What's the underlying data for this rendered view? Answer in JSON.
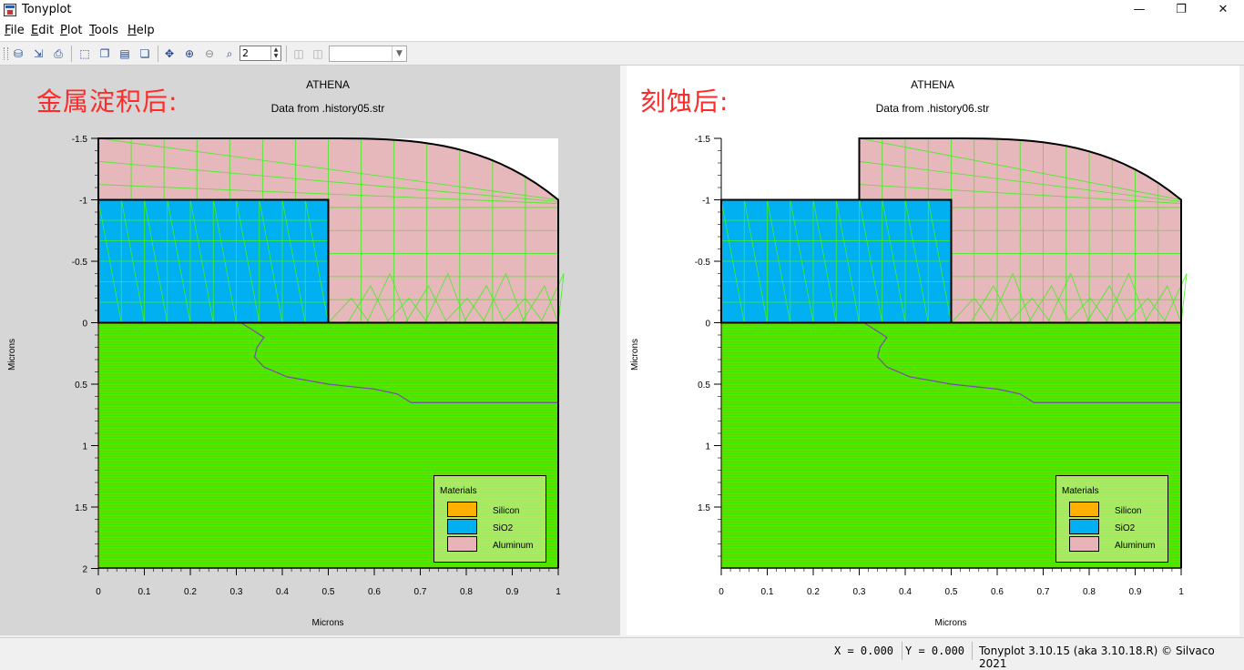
{
  "window": {
    "title": "Tonyplot",
    "minimize": "—",
    "maximize": "❐",
    "close": "✕"
  },
  "menu": [
    {
      "pre": "",
      "u": "F",
      "post": "ile"
    },
    {
      "pre": "",
      "u": "E",
      "post": "dit"
    },
    {
      "pre": "",
      "u": "P",
      "post": "lot"
    },
    {
      "pre": "",
      "u": "T",
      "post": "ools"
    },
    {
      "pre": "",
      "u": "H",
      "post": "elp"
    }
  ],
  "toolbar": {
    "icons": [
      "open-icon",
      "import-icon",
      "print-icon",
      "select-icon",
      "copy-icon",
      "delete-icon",
      "duplicate-icon",
      "pan-icon",
      "zoom-in-icon",
      "zoom-out-icon",
      "zoom-fit-icon"
    ],
    "zoom_value": "2",
    "extra_icons": [
      "prev-plot-icon",
      "next-plot-icon"
    ],
    "plot_select": ""
  },
  "plots": [
    {
      "annotation": "金属淀积后:",
      "title": "ATHENA",
      "subtitle": "Data from .history05.str",
      "ylabel": "Microns",
      "xlabel": "Microns",
      "xticks": [
        "0",
        "0.1",
        "0.2",
        "0.3",
        "0.4",
        "0.5",
        "0.6",
        "0.7",
        "0.8",
        "0.9",
        "1"
      ],
      "yticks": [
        "-1.5",
        "-1",
        "-0.5",
        "0",
        "0.5",
        "1",
        "1.5",
        "2"
      ],
      "etched": false,
      "legend": {
        "title": "Materials",
        "items": [
          {
            "label": "Silicon",
            "color": "#ffb000"
          },
          {
            "label": "SiO2",
            "color": "#00b0f0"
          },
          {
            "label": "Aluminum",
            "color": "#e8b4b8"
          }
        ]
      }
    },
    {
      "annotation": "刻蚀后:",
      "title": "ATHENA",
      "subtitle": "Data from .history06.str",
      "ylabel": "Microns",
      "xlabel": "Microns",
      "xticks": [
        "0",
        "0.1",
        "0.2",
        "0.3",
        "0.4",
        "0.5",
        "0.6",
        "0.7",
        "0.8",
        "0.9",
        "1"
      ],
      "yticks": [
        "-1.5",
        "-1",
        "-0.5",
        "0",
        "0.5",
        "1",
        "1.5"
      ],
      "etched": true,
      "legend": {
        "title": "Materials",
        "items": [
          {
            "label": "Silicon",
            "color": "#ffb000"
          },
          {
            "label": "SiO2",
            "color": "#00b0f0"
          },
          {
            "label": "Aluminum",
            "color": "#e8b4b8"
          }
        ]
      }
    }
  ],
  "status": {
    "x": "X = 0.000",
    "y": "Y = 0.000",
    "version": "Tonyplot 3.10.15 (aka 3.10.18.R) © Silvaco 2021"
  }
}
